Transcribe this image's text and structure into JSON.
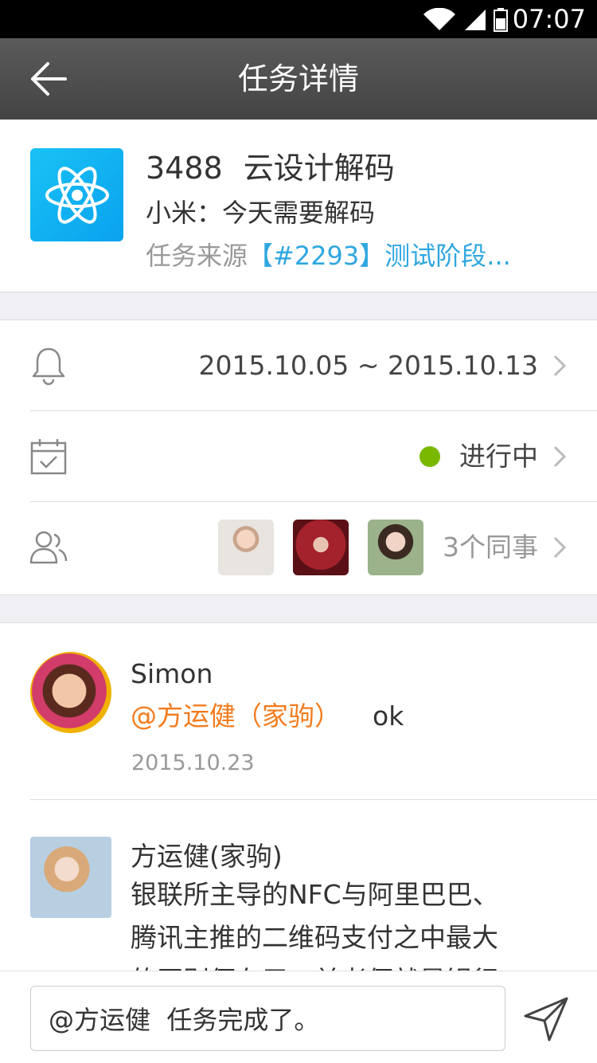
{
  "status_bar": {
    "time": "07:07"
  },
  "nav": {
    "title": "任务详情"
  },
  "task": {
    "number": "3488",
    "name": "云设计解码",
    "subtitle": "小米：今天需要解码",
    "source_label": "任务来源",
    "source_link": "【#2293】测试阶段..."
  },
  "info": {
    "date_range": "2015.10.05 ~ 2015.10.13",
    "status": "进行中",
    "colleagues_label": "3个同事"
  },
  "comments": [
    {
      "author": "Simon",
      "mention": "@方运健（家驹）",
      "text": "ok",
      "date": "2015.10.23"
    },
    {
      "author": "方运健(家驹)",
      "lines": [
        "银联所主导的NFC与阿里巴巴、",
        "腾讯主推的二维码支付之中最大",
        "的区别便在于，前者便就是银行"
      ]
    }
  ],
  "input": {
    "value": "@方运健  任务完成了。"
  },
  "colors": {
    "accent": "#2fa7e0",
    "mention": "#f37b1d",
    "status_green": "#7ab800"
  }
}
